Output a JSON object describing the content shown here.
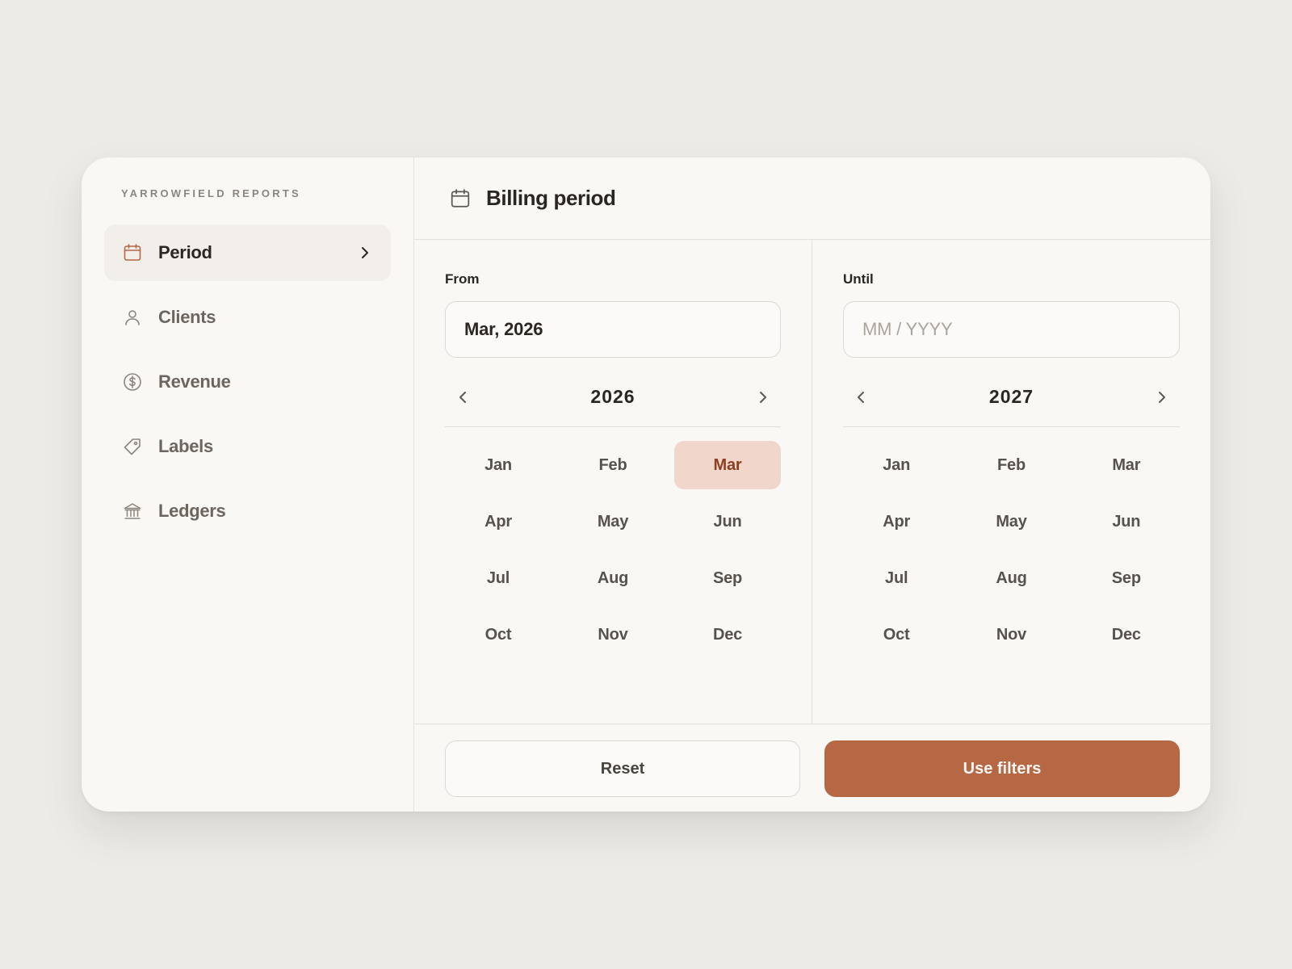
{
  "brand": "YARROWFIELD REPORTS",
  "sidebar": {
    "items": [
      {
        "label": "Period",
        "icon": "calendar-icon",
        "active": true
      },
      {
        "label": "Clients",
        "icon": "user-icon"
      },
      {
        "label": "Revenue",
        "icon": "dollar-icon"
      },
      {
        "label": "Labels",
        "icon": "tag-icon"
      },
      {
        "label": "Ledgers",
        "icon": "bank-icon"
      }
    ]
  },
  "header": {
    "title": "Billing period",
    "icon": "calendar-icon"
  },
  "from": {
    "label": "From",
    "value": "Mar, 2026",
    "placeholder": "MM / YYYY",
    "year": "2026",
    "selected_month": "Mar"
  },
  "until": {
    "label": "Until",
    "value": "",
    "placeholder": "MM / YYYY",
    "year": "2027",
    "selected_month": ""
  },
  "months": [
    "Jan",
    "Feb",
    "Mar",
    "Apr",
    "May",
    "Jun",
    "Jul",
    "Aug",
    "Sep",
    "Oct",
    "Nov",
    "Dec"
  ],
  "footer": {
    "reset_label": "Reset",
    "apply_label": "Use filters"
  },
  "colors": {
    "accent": "#b66744",
    "accent_soft": "#f1d6cb",
    "background": "#edebe7",
    "card": "#f9f8f5"
  }
}
